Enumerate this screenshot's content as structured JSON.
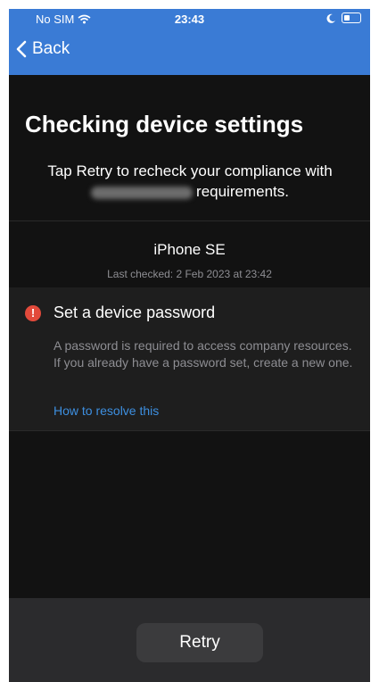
{
  "status_bar": {
    "carrier": "No SIM",
    "time": "23:43"
  },
  "nav": {
    "back_label": "Back"
  },
  "main": {
    "title": "Checking device settings",
    "subtitle_line1": "Tap Retry to recheck your compliance with",
    "subtitle_line2": "requirements.",
    "device_name": "iPhone SE",
    "last_checked": "Last checked: 2 Feb 2023 at 23:42"
  },
  "issue": {
    "title": "Set a device password",
    "description": "A password is required to access company resources. If you already have a password set, create a new one.",
    "resolve_link": "How to resolve this"
  },
  "actions": {
    "retry_label": "Retry"
  },
  "colors": {
    "accent": "#3a7bd5",
    "link": "#3d8fe0",
    "alert": "#e24a3b",
    "background": "#121212"
  },
  "icons": [
    "wifi-icon",
    "moon-icon",
    "battery-icon",
    "chevron-left-icon",
    "exclamation-icon"
  ]
}
